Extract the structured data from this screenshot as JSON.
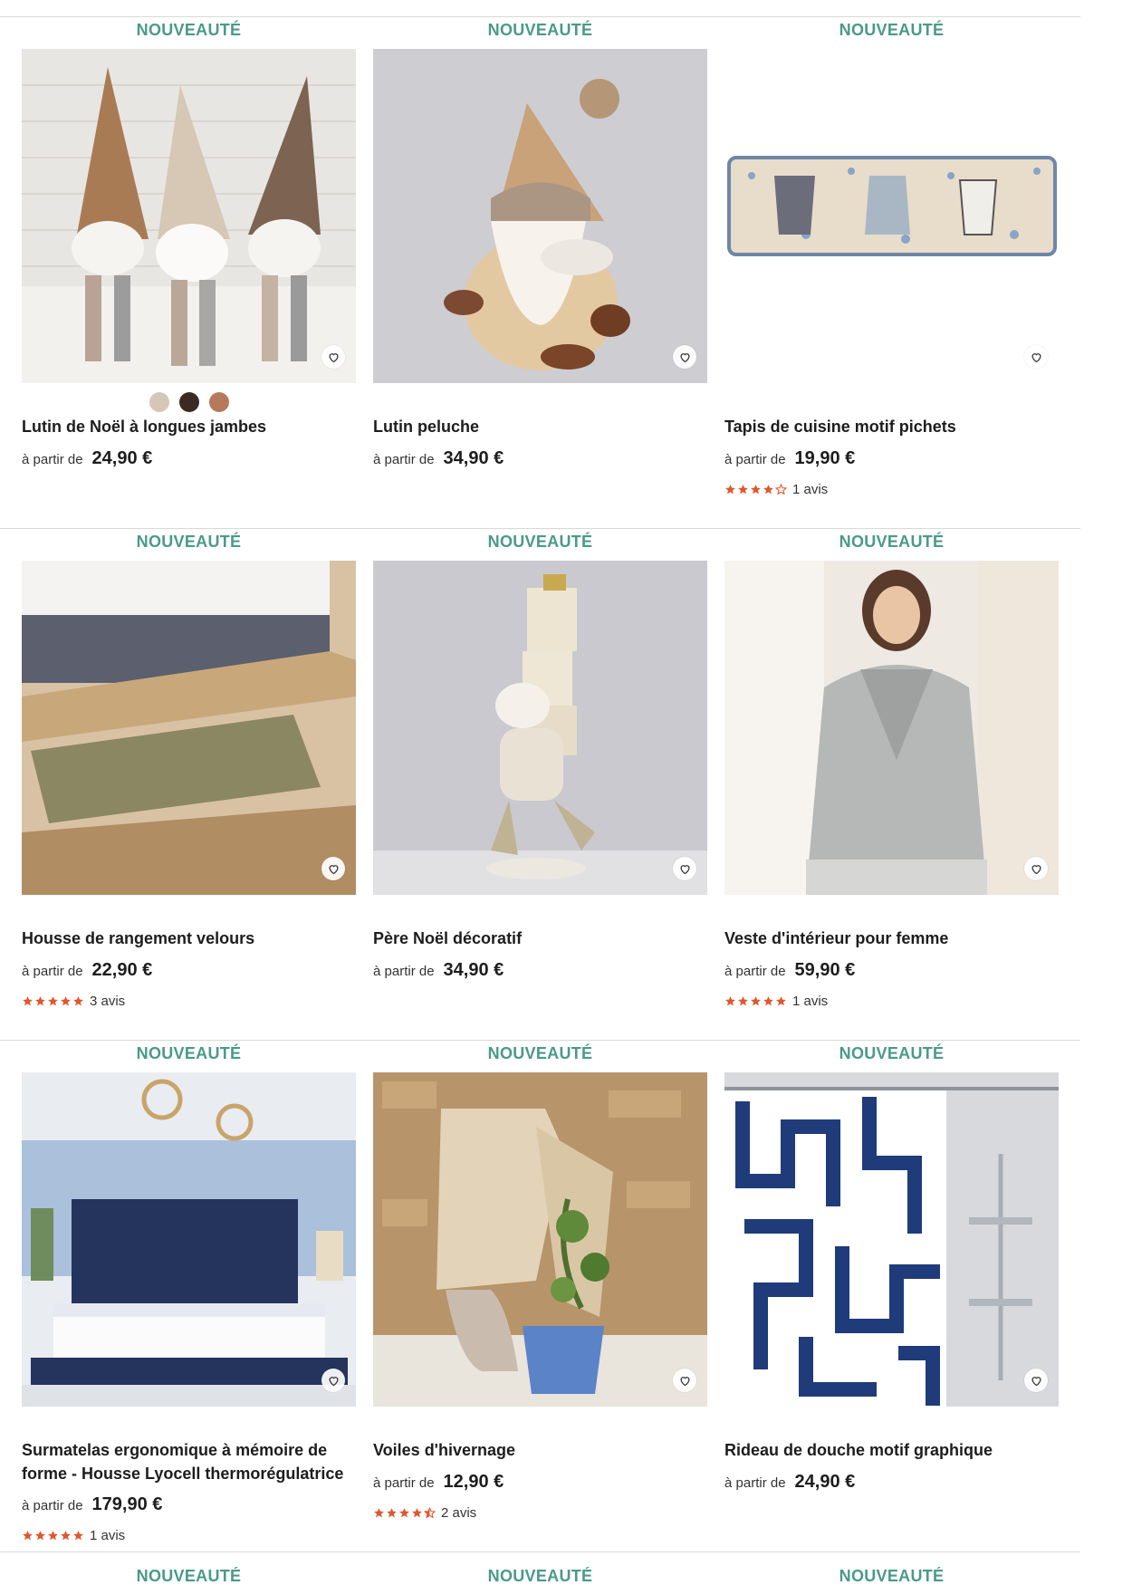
{
  "badge_label": "NOUVEAUTÉ",
  "price_prefix": "à partir de",
  "favorite_icon": "heart-icon",
  "colors": {
    "badge": "#4a9a88",
    "star": "#e0572f"
  },
  "products": [
    {
      "title": "Lutin de Noël à longues jambes",
      "price": "24,90 €",
      "swatches": [
        "#d6c6b8",
        "#3b2a22",
        "#b47a5a"
      ]
    },
    {
      "title": "Lutin peluche",
      "price": "34,90 €"
    },
    {
      "title": "Tapis de cuisine motif pichets",
      "price": "19,90 €",
      "rating": 4,
      "reviews": "1 avis"
    },
    {
      "title": "Housse de rangement velours",
      "price": "22,90 €",
      "rating": 5,
      "reviews": "3 avis"
    },
    {
      "title": "Père Noël décoratif",
      "price": "34,90 €"
    },
    {
      "title": "Veste d'intérieur pour femme",
      "price": "59,90 €",
      "rating": 5,
      "reviews": "1 avis"
    },
    {
      "title": "Surmatelas ergonomique à mémoire de forme - Housse Lyocell thermorégulatrice",
      "price": "179,90 €",
      "rating": 5,
      "reviews": "1 avis"
    },
    {
      "title": "Voiles d'hivernage",
      "price": "12,90 €",
      "rating": 4.5,
      "reviews": "2 avis"
    },
    {
      "title": "Rideau de douche motif graphique",
      "price": "24,90 €"
    }
  ]
}
